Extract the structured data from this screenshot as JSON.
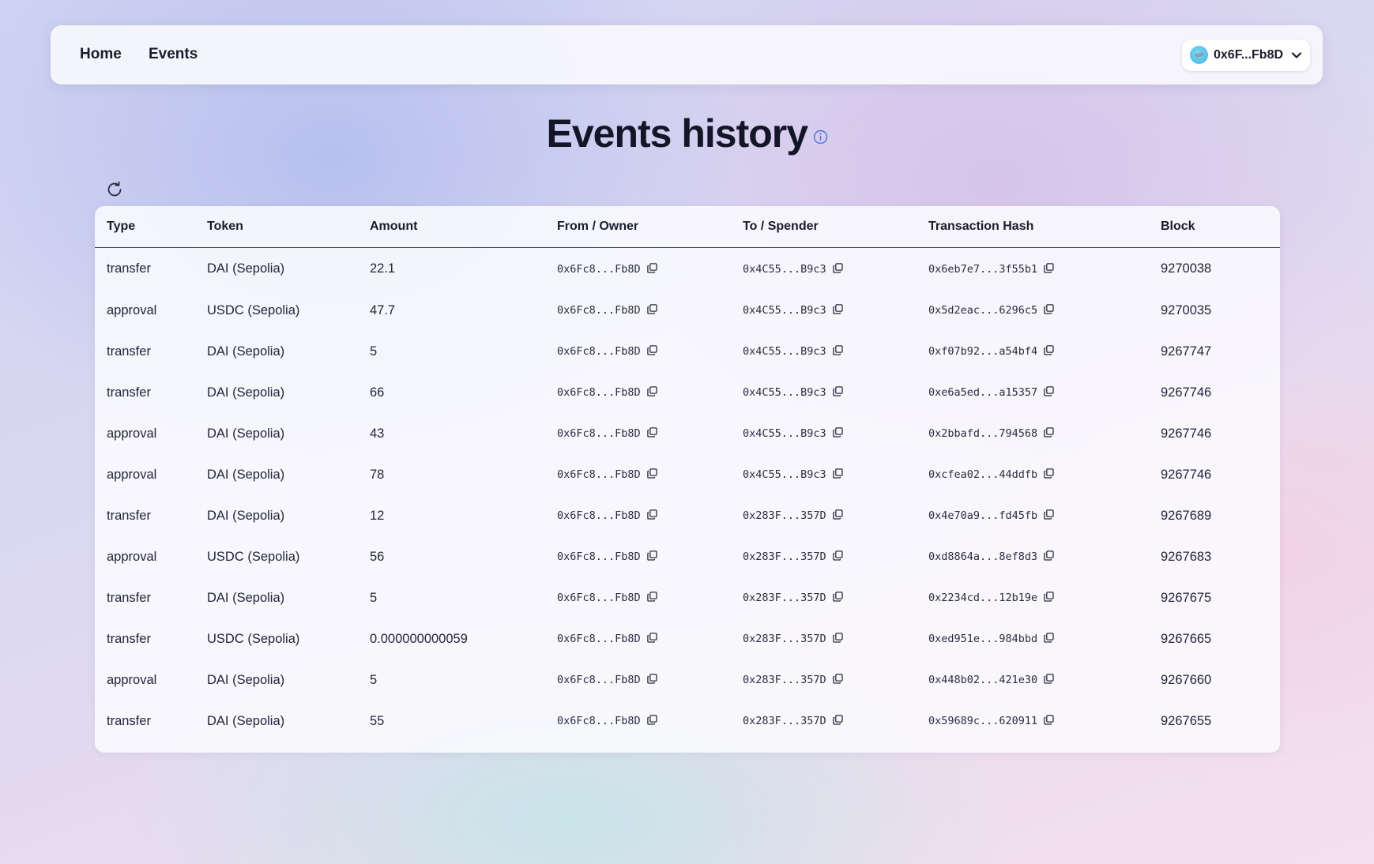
{
  "nav": {
    "links": [
      {
        "label": "Home"
      },
      {
        "label": "Events"
      }
    ],
    "wallet": {
      "address": "0x6F...Fb8D",
      "avatar_color": "#4bbde8"
    }
  },
  "page": {
    "title": "Events history",
    "info_icon": "info-circle-icon",
    "refresh_icon": "refresh-icon"
  },
  "colors": {
    "accent": "#4a74d9",
    "text": "#1a1c2b"
  },
  "table": {
    "columns": [
      "Type",
      "Token",
      "Amount",
      "From / Owner",
      "To / Spender",
      "Transaction Hash",
      "Block"
    ],
    "rows": [
      {
        "type": "transfer",
        "token": "DAI (Sepolia)",
        "amount": "22.1",
        "from": "0x6Fc8...Fb8D",
        "to": "0x4C55...B9c3",
        "hash": "0x6eb7e7...3f55b1",
        "block": "9270038"
      },
      {
        "type": "approval",
        "token": "USDC (Sepolia)",
        "amount": "47.7",
        "from": "0x6Fc8...Fb8D",
        "to": "0x4C55...B9c3",
        "hash": "0x5d2eac...6296c5",
        "block": "9270035"
      },
      {
        "type": "transfer",
        "token": "DAI (Sepolia)",
        "amount": "5",
        "from": "0x6Fc8...Fb8D",
        "to": "0x4C55...B9c3",
        "hash": "0xf07b92...a54bf4",
        "block": "9267747"
      },
      {
        "type": "transfer",
        "token": "DAI (Sepolia)",
        "amount": "66",
        "from": "0x6Fc8...Fb8D",
        "to": "0x4C55...B9c3",
        "hash": "0xe6a5ed...a15357",
        "block": "9267746"
      },
      {
        "type": "approval",
        "token": "DAI (Sepolia)",
        "amount": "43",
        "from": "0x6Fc8...Fb8D",
        "to": "0x4C55...B9c3",
        "hash": "0x2bbafd...794568",
        "block": "9267746"
      },
      {
        "type": "approval",
        "token": "DAI (Sepolia)",
        "amount": "78",
        "from": "0x6Fc8...Fb8D",
        "to": "0x4C55...B9c3",
        "hash": "0xcfea02...44ddfb",
        "block": "9267746"
      },
      {
        "type": "transfer",
        "token": "DAI (Sepolia)",
        "amount": "12",
        "from": "0x6Fc8...Fb8D",
        "to": "0x283F...357D",
        "hash": "0x4e70a9...fd45fb",
        "block": "9267689"
      },
      {
        "type": "approval",
        "token": "USDC (Sepolia)",
        "amount": "56",
        "from": "0x6Fc8...Fb8D",
        "to": "0x283F...357D",
        "hash": "0xd8864a...8ef8d3",
        "block": "9267683"
      },
      {
        "type": "transfer",
        "token": "DAI (Sepolia)",
        "amount": "5",
        "from": "0x6Fc8...Fb8D",
        "to": "0x283F...357D",
        "hash": "0x2234cd...12b19e",
        "block": "9267675"
      },
      {
        "type": "transfer",
        "token": "USDC (Sepolia)",
        "amount": "0.000000000059",
        "from": "0x6Fc8...Fb8D",
        "to": "0x283F...357D",
        "hash": "0xed951e...984bbd",
        "block": "9267665"
      },
      {
        "type": "approval",
        "token": "DAI (Sepolia)",
        "amount": "5",
        "from": "0x6Fc8...Fb8D",
        "to": "0x283F...357D",
        "hash": "0x448b02...421e30",
        "block": "9267660"
      },
      {
        "type": "transfer",
        "token": "DAI (Sepolia)",
        "amount": "55",
        "from": "0x6Fc8...Fb8D",
        "to": "0x283F...357D",
        "hash": "0x59689c...620911",
        "block": "9267655"
      }
    ]
  }
}
